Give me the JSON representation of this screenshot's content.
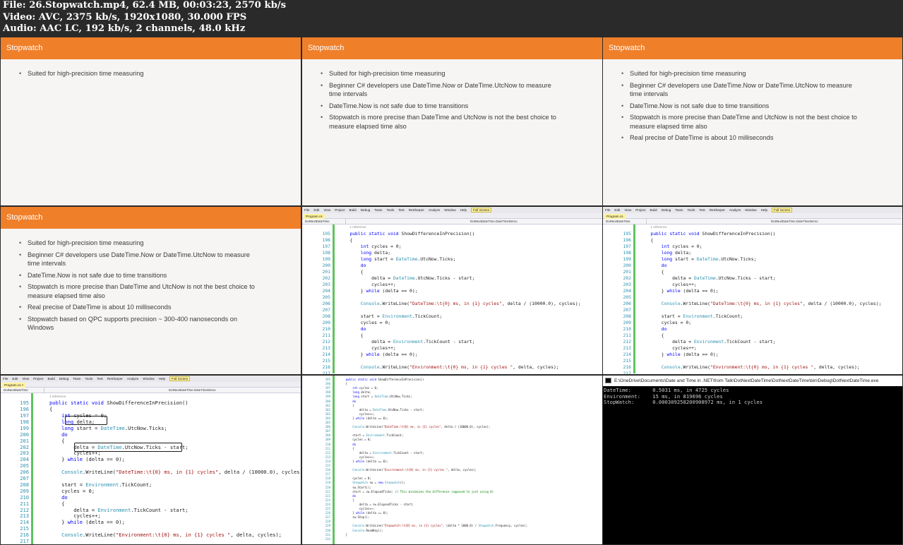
{
  "header": {
    "lines": [
      "File: 26.Stopwatch.mp4, 62.4 MB, 00:03:23, 2570 kb/s",
      "Video: AVC, 2375 kb/s, 1920x1080, 30.000 FPS",
      "Audio: AAC LC, 192 kb/s, 2 channels, 48.0 kHz"
    ]
  },
  "slides": [
    {
      "title": "Stopwatch",
      "bullets": [
        "Suited for high-precision time measuring"
      ]
    },
    {
      "title": "Stopwatch",
      "bullets": [
        "Suited for high-precision time measuring",
        "Beginner C# developers use DateTime.Now or DateTime.UtcNow to measure time intervals",
        "DateTime.Now is not safe due to time transitions",
        "Stopwatch is more precise than DateTime and UtcNow is not the best choice to measure elapsed time also"
      ]
    },
    {
      "title": "Stopwatch",
      "bullets": [
        "Suited for high-precision time measuring",
        "Beginner C# developers use DateTime.Now or DateTime.UtcNow to measure time intervals",
        "DateTime.Now is not safe due to time transitions",
        "Stopwatch is more precise than DateTime and UtcNow is not the best choice to measure elapsed time also",
        "Real precise of DateTime is about 10 milliseconds"
      ]
    },
    {
      "title": "Stopwatch",
      "bullets": [
        "Suited for high-precision time measuring",
        "Beginner C# developers use DateTime.Now or DateTime.UtcNow to measure time intervals",
        "DateTime.Now is not safe due to time transitions",
        "Stopwatch is more precise than DateTime and UtcNow is not the best choice to measure elapsed time also",
        "Real precise of DateTime is about 10 milliseconds",
        "Stopwatch based on QPC supports precision ~ 300-400 nanoseconds on Windows"
      ]
    }
  ],
  "ide": {
    "menu": [
      "File",
      "Edit",
      "View",
      "Project",
      "Build",
      "Debug",
      "Team",
      "Tools",
      "Test",
      "ReSharper",
      "Analyze",
      "Window",
      "Help"
    ],
    "fullscreen_label": "Full Screen",
    "tab_label": "Program.cs",
    "tab_label_close": "Program.cs ×",
    "nav_left": "DotNextDateTime",
    "nav_right": "DotNextDateTime.DateTimeDemo",
    "references_label": "1 reference",
    "code_lines": [
      [
        "195",
        "public static void ShowDifferenceInPrecision()"
      ],
      [
        "196",
        "{"
      ],
      [
        "197",
        "    int cycles = 0;"
      ],
      [
        "198",
        "    long delta;"
      ],
      [
        "199",
        "    long start = DateTime.UtcNow.Ticks;"
      ],
      [
        "200",
        "    do"
      ],
      [
        "201",
        "    {"
      ],
      [
        "202",
        "        delta = DateTime.UtcNow.Ticks - start;"
      ],
      [
        "203",
        "        cycles++;"
      ],
      [
        "204",
        "    } while (delta == 0);"
      ],
      [
        "205",
        ""
      ],
      [
        "206",
        "    Console.WriteLine(\"DateTime:\\t{0} ms, in {1} cycles\", delta / (10000.0), cycles);"
      ],
      [
        "207",
        ""
      ],
      [
        "208",
        "    start = Environment.TickCount;"
      ],
      [
        "209",
        "    cycles = 0;"
      ],
      [
        "210",
        "    do"
      ],
      [
        "211",
        "    {"
      ],
      [
        "212",
        "        delta = Environment.TickCount - start;"
      ],
      [
        "213",
        "        cycles++;"
      ],
      [
        "214",
        "    } while (delta == 0);"
      ],
      [
        "215",
        ""
      ],
      [
        "216",
        "    Console.WriteLine(\"Environment:\\t{0} ms, in {1} cycles \", delta, cycles);"
      ],
      [
        "217",
        ""
      ]
    ],
    "small_code_lines": [
      [
        "195",
        "public static void ShowDifferenceInPrecision()"
      ],
      [
        "196",
        "{"
      ],
      [
        "197",
        "    int cycles = 0;"
      ],
      [
        "198",
        "    long delta;"
      ],
      [
        "199",
        "    long start = DateTime.UtcNow.Ticks;"
      ],
      [
        "200",
        "    do"
      ],
      [
        "201",
        "    {"
      ],
      [
        "202",
        "        delta = DateTime.UtcNow.Ticks - start;"
      ],
      [
        "203",
        "        cycles++;"
      ],
      [
        "204",
        "    } while (delta == 0);"
      ],
      [
        "205",
        ""
      ],
      [
        "206",
        "    Console.WriteLine(\"DateTime:\\t{0} ms, in {1} cycles\", delta / (10000.0), cycles);"
      ],
      [
        "207",
        ""
      ],
      [
        "208",
        "    start = Environment.TickCount;"
      ],
      [
        "209",
        "    cycles = 0;"
      ],
      [
        "210",
        "    do"
      ],
      [
        "211",
        "    {"
      ],
      [
        "212",
        "        delta = Environment.TickCount - start;"
      ],
      [
        "213",
        "        cycles++;"
      ],
      [
        "214",
        "    } while (delta == 0);"
      ],
      [
        "215",
        ""
      ],
      [
        "216",
        "    Console.WriteLine(\"Environment:\\t{0} ms, in {1} cycles \", delta, cycles);"
      ],
      [
        "217",
        ""
      ],
      [
        "218",
        "    cycles = 0;"
      ],
      [
        "219",
        "    Stopwatch sw = new Stopwatch();"
      ],
      [
        "220",
        "    sw.Start();"
      ],
      [
        "221",
        "    start = sw.ElapsedTicks; // This minimizes the difference (opposed to just using 0)"
      ],
      [
        "222",
        "    do"
      ],
      [
        "223",
        "    {"
      ],
      [
        "224",
        "        delta = sw.ElapsedTicks - start;"
      ],
      [
        "225",
        "        cycles++;"
      ],
      [
        "226",
        "    } while (delta == 0);"
      ],
      [
        "227",
        "    sw.Stop();"
      ],
      [
        "228",
        ""
      ],
      [
        "229",
        "    Console.WriteLine(\"Stopwatch:\\t{0} ms, in {1} cycles\", (delta * 1000.0) / Stopwatch.Frequency, cycles);"
      ],
      [
        "230",
        "    Console.ReadKey();"
      ],
      [
        "231",
        "}"
      ],
      [
        "232",
        ""
      ]
    ]
  },
  "console": {
    "title": "E:\\OneDrive\\Documents\\Date and Time in .NET\\from Talk\\DotNextDateTime\\DotNextDateTime\\bin\\Debug\\DotNextDateTime.exe",
    "lines": [
      "DateTime:       0.5031 ms, in 4725 cycles",
      "Environment:    15 ms, in 819696 cycles",
      "StopWatch:      0.000309258200908972 ms, in 1 cycles"
    ]
  },
  "colors": {
    "slide_title_bg": "#f07f2a",
    "header_bg": "#2a2a2a",
    "keyword": "#0000ff",
    "type": "#2b91af",
    "string": "#a31515",
    "change_bar": "#5fc35f"
  }
}
